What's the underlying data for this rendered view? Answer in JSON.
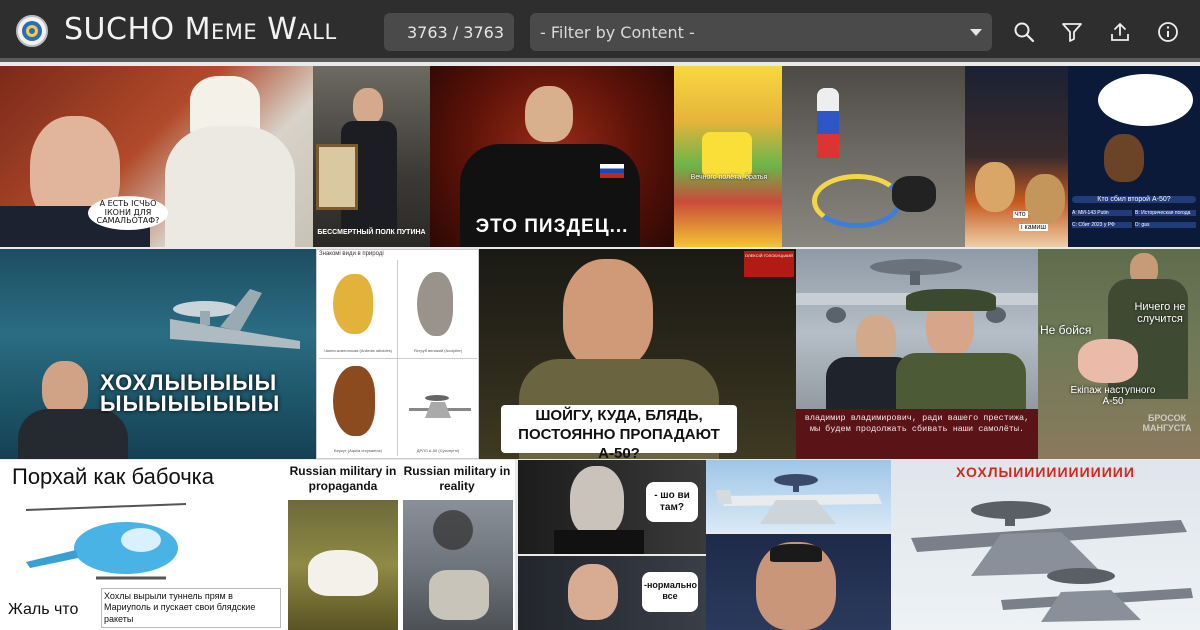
{
  "header": {
    "title": "SUCHO Meme Wall",
    "counter_text": "3763 / 3763",
    "filter_placeholder": "- Filter by Content -",
    "icons": [
      "search-icon",
      "filter-icon",
      "upload-icon",
      "info-icon"
    ]
  },
  "colors": {
    "topbar": "#2e2e2e",
    "control_bg": "#4a4a4a",
    "text_light": "#f2f2f2"
  },
  "memes": {
    "m1_bubble": "А ЕСТЬ ІСЧЬО ІКОНИ ДЛЯ САМАЛЬОТАФ?",
    "m2_caption": "БЕССМЕРТНЫЙ ПОЛК ПУТИНА",
    "m3_caption": "ЭТО ПИЗДЕЦ...",
    "m4_caption": "Вечного полёта, братья",
    "m6_caption": "что",
    "m6_caption2": "і камиш",
    "m7_question": "Кто сбил второй А-50?",
    "m7_a": "A: МИ-143 Putin",
    "m7_b": "B: Историческая погода",
    "m7_c": "C: Сбит 2023 у РФ",
    "m7_d": "D: gas",
    "m8_caption": "ХОХЛЫЫЫЫЫ ЫЫЫЫЫЫЫЫ",
    "m9_header": "Знакомі види в природі",
    "m9_l1": "Чапля жовтоносая (Ardeola ralloides)",
    "m9_l2": "Яструб великий (Accipiter)",
    "m9_l3": "Беркут (Aquila chrysaetos)",
    "m9_l4": "ДРЛО А-50 (Сухопутні)",
    "m10_caption": "ШОЙГУ, КУДА, БЛЯДЬ, ПОСТОЯННО ПРОПАДАЮТ А-50?",
    "m10_badge": "ОЛЕКСІЙ ГОЛОБУЦЬКИЙ",
    "m11_caption": "владимир владимирович, ради вашего престижа, мы будем продолжать сбивать наши самолёты.",
    "m12_text1": "Не бойся",
    "m12_text2": "Ничего не случится",
    "m12_text3": "Екіпаж наступного А-50",
    "m12_watermark": "БРОСОК МАНГУСТА",
    "m13_title": "Порхай как бабочка",
    "m13_bottom": "Жаль что",
    "m13_note": "Хохлы вырыли туннель прям в Мариуполь и пускает свои блядские ракеты",
    "m14_left": "Russian military in propaganda",
    "m14_right": "Russian military in reality",
    "m15_b1": "- шо ви там?",
    "m15_b2": "-нормально все",
    "m17_title": "ХОХЛЫИИИИИИИИИИИ"
  }
}
